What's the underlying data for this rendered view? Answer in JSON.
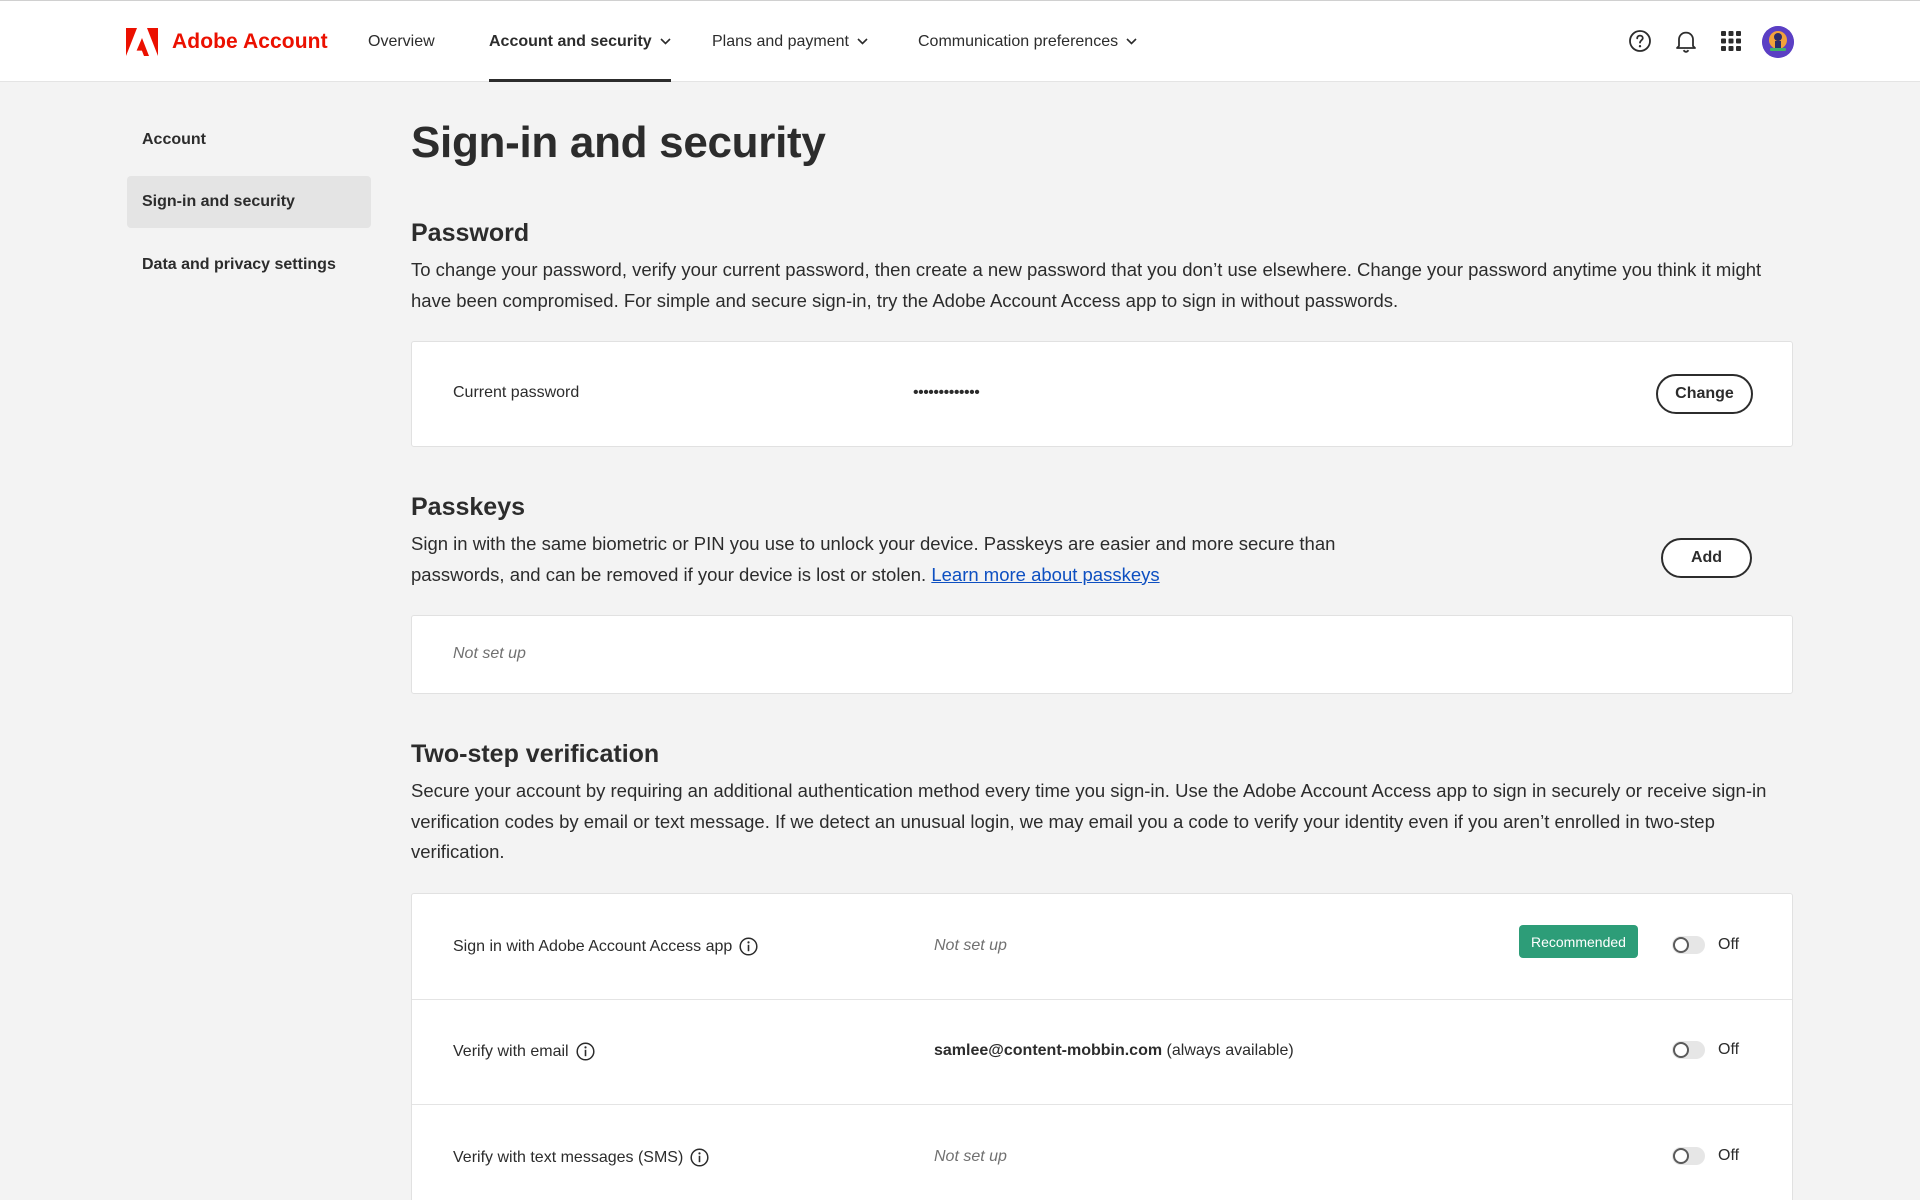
{
  "header": {
    "brand": "Adobe Account",
    "nav": [
      {
        "label": "Overview"
      },
      {
        "label": "Account and security"
      },
      {
        "label": "Plans and payment"
      },
      {
        "label": "Communication preferences"
      }
    ]
  },
  "sidebar": {
    "items": [
      {
        "label": "Account"
      },
      {
        "label": "Sign-in and security"
      },
      {
        "label": "Data and privacy settings"
      }
    ]
  },
  "page": {
    "title": "Sign-in and security"
  },
  "password": {
    "title": "Password",
    "description": "To change your password, verify your current password, then create a new password that you don’t use elsewhere. Change your password anytime you think it might have been compromised. For simple and secure sign-in, try the Adobe Account Access app to sign in without passwords.",
    "current_label": "Current password",
    "current_value": "•••••••••••••",
    "change_label": "Change"
  },
  "passkeys": {
    "title": "Passkeys",
    "description": "Sign in with the same biometric or PIN you use to unlock your device. Passkeys are easier and more secure than passwords, and can be removed if your device is lost or stolen.",
    "learn_more": "Learn more about passkeys",
    "add_label": "Add",
    "status": "Not set up"
  },
  "two_step": {
    "title": "Two-step verification",
    "description": "Secure your account by requiring an additional authentication method every time you sign-in. Use the Adobe Account Access app to sign in securely or receive sign-in verification codes by email or text message. If we detect an unusual login, we may email you a code to verify your identity even if you aren’t enrolled in two-step verification.",
    "rows": [
      {
        "label": "Sign in with Adobe Account Access app",
        "status": "Not set up",
        "badge": "Recommended",
        "toggle": "Off"
      },
      {
        "label": "Verify with email",
        "email": "samlee@content-mobbin.com",
        "note": "(always available)",
        "toggle": "Off"
      },
      {
        "label": "Verify with text messages (SMS)",
        "status": "Not set up",
        "toggle": "Off"
      }
    ]
  },
  "colors": {
    "brand": "#eb1000",
    "link": "#0d4fc1",
    "badge": "#2d9d78",
    "background": "#f3f3f3"
  }
}
